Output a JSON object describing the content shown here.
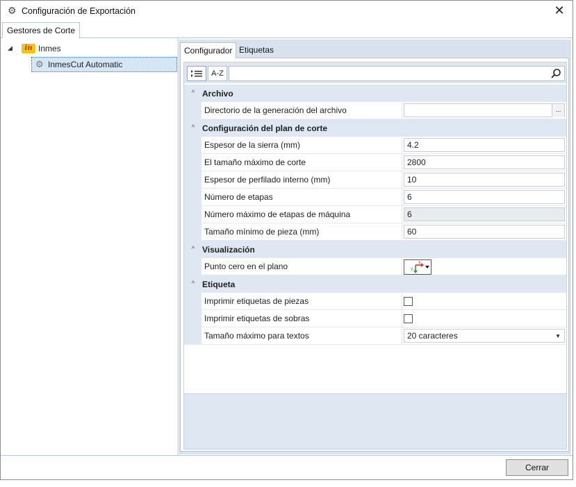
{
  "window": {
    "title": "Configuración de Exportación",
    "icon": "gear-icon",
    "close_label": "✕"
  },
  "outer_tab": {
    "label": "Gestores de Corte"
  },
  "tree": {
    "root_label": "Inmes",
    "root_logo_text": "in",
    "child_label": "InmesCut Automatic"
  },
  "inner_tabs": [
    {
      "label": "Configurador"
    },
    {
      "label": "Etiquetas"
    }
  ],
  "toolbar": {
    "categorized_icon": "categorized-view-icon",
    "alphabetical_label": "A-Z",
    "search_value": ""
  },
  "categories": [
    {
      "label": "Archivo",
      "props": [
        {
          "name": "Directorio de la generación del archivo",
          "value": "",
          "browse": "..."
        }
      ]
    },
    {
      "label": "Configuración del plan de corte",
      "props": [
        {
          "name": "Espesor de la sierra (mm)",
          "value": "4.2"
        },
        {
          "name": "El tamaño máximo de corte",
          "value": "2800"
        },
        {
          "name": "Espesor de perfilado interno (mm)",
          "value": "10"
        },
        {
          "name": "Número de etapas",
          "value": "6"
        },
        {
          "name": "Número máximo de etapas de máquina",
          "value": "6"
        },
        {
          "name": "Tamaño mínimo de pieza (mm)",
          "value": "60"
        }
      ]
    },
    {
      "label": "Visualización",
      "props": [
        {
          "name": "Punto cero en el plano",
          "value": "",
          "axis_x": "x",
          "axis_y": "y"
        }
      ]
    },
    {
      "label": "Etiqueta",
      "props": [
        {
          "name": "Imprimir etiquetas de piezas",
          "checked": false
        },
        {
          "name": "Imprimir etiquetas de sobras",
          "checked": false
        },
        {
          "name": "Tamaño máximo para textos",
          "value": "20 caracteres"
        }
      ]
    }
  ],
  "footer": {
    "close_button": "Cerrar"
  },
  "colors": {
    "accent": "#dfe8f2",
    "selection": "#d5e6f7"
  }
}
